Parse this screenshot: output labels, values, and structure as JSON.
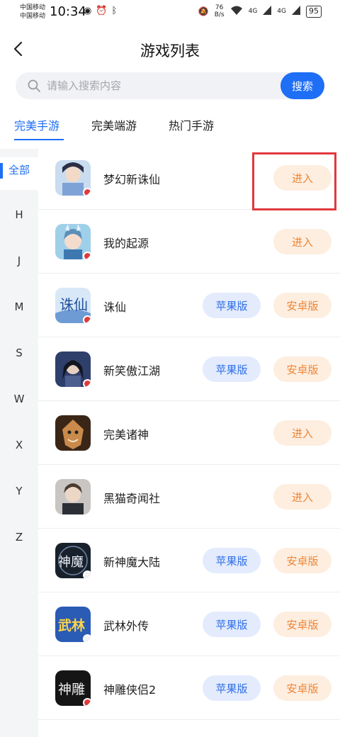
{
  "status_bar": {
    "carrier_1": "中国移动",
    "carrier_2": "中国移动",
    "time": "10:34",
    "net_speed_value": "76",
    "net_speed_unit": "B/s",
    "signal_1": "4G",
    "signal_2": "4G",
    "battery": "95"
  },
  "header": {
    "title": "游戏列表"
  },
  "search": {
    "placeholder": "请输入搜索内容",
    "button_label": "搜索"
  },
  "tabs": [
    {
      "label": "完美手游",
      "active": true
    },
    {
      "label": "完美端游",
      "active": false
    },
    {
      "label": "热门手游",
      "active": false
    }
  ],
  "index": [
    {
      "label": "全部",
      "active": true
    },
    {
      "label": "H"
    },
    {
      "label": "J"
    },
    {
      "label": "M"
    },
    {
      "label": "S"
    },
    {
      "label": "W"
    },
    {
      "label": "X"
    },
    {
      "label": "Y"
    },
    {
      "label": "Z"
    }
  ],
  "games": [
    {
      "name": "梦幻新诛仙",
      "buttons": [
        "进入"
      ],
      "icon_color": "#b8cfe8",
      "icon": "game-icon-menghuanxinzhuxian"
    },
    {
      "name": "我的起源",
      "buttons": [
        "进入"
      ],
      "icon_color": "#7fb7d9",
      "icon": "game-icon-wodeqiyuan"
    },
    {
      "name": "诛仙",
      "buttons": [
        "苹果版",
        "安卓版"
      ],
      "icon_color": "#5d86c4",
      "icon": "game-icon-zhuxian",
      "icon_text": "诛仙"
    },
    {
      "name": "新笑傲江湖",
      "buttons": [
        "苹果版",
        "安卓版"
      ],
      "icon_color": "#3a4f80",
      "icon": "game-icon-xinxiaoaojianghu"
    },
    {
      "name": "完美诸神",
      "buttons": [
        "进入"
      ],
      "icon_color": "#6b4a2e",
      "icon": "game-icon-wanmeizhushen"
    },
    {
      "name": "黑猫奇闻社",
      "buttons": [
        "进入"
      ],
      "icon_color": "#4a4f59",
      "icon": "game-icon-heimaoqiwenshe"
    },
    {
      "name": "新神魔大陆",
      "buttons": [
        "苹果版",
        "安卓版"
      ],
      "icon_color": "#1f2a3a",
      "icon": "game-icon-xinshenmodalu",
      "icon_text": "神魔"
    },
    {
      "name": "武林外传",
      "buttons": [
        "苹果版",
        "安卓版"
      ],
      "icon_color": "#2d5db8",
      "icon": "game-icon-wulinwaizhuan",
      "icon_text": "武林"
    },
    {
      "name": "神雕侠侣2",
      "buttons": [
        "苹果版",
        "安卓版"
      ],
      "icon_color": "#1b1b1b",
      "icon": "game-icon-shendiaoxialv2",
      "icon_text": "神雕"
    }
  ],
  "colors": {
    "accent": "#1e6ef6",
    "enter_bg": "#fdeee0",
    "enter_text": "#ee8535",
    "apple_bg": "#e3ebfd",
    "apple_text": "#2f6fe6",
    "highlight": "#e0383e"
  }
}
